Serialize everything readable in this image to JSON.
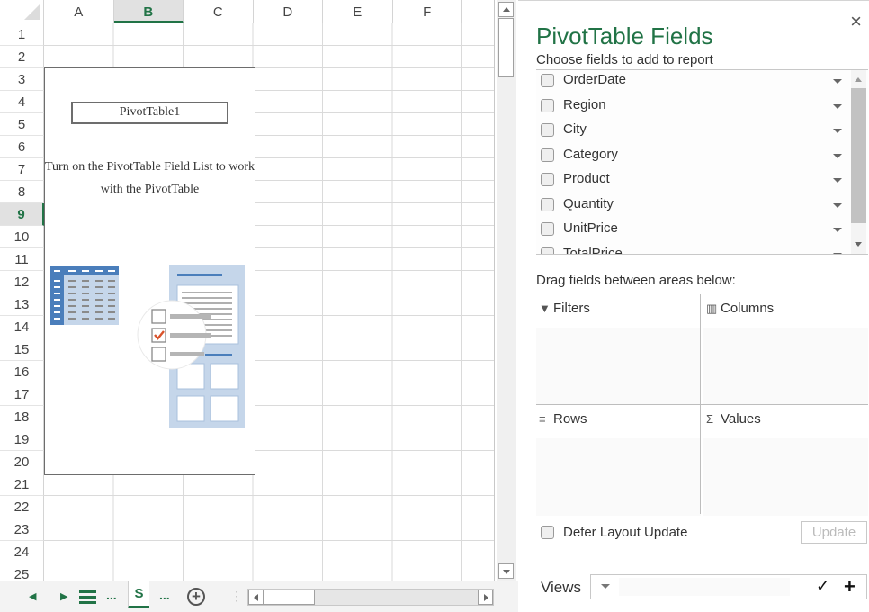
{
  "sheet": {
    "columns": [
      "A",
      "B",
      "C",
      "D",
      "E",
      "F"
    ],
    "selected_column": "B",
    "rows": [
      "1",
      "2",
      "3",
      "4",
      "5",
      "6",
      "7",
      "8",
      "9",
      "10",
      "11",
      "12",
      "13",
      "14",
      "15",
      "16",
      "17",
      "18",
      "19",
      "20",
      "21",
      "22",
      "23",
      "24",
      "25"
    ],
    "selected_row": "9",
    "pivot_placeholder": {
      "name": "PivotTable1",
      "message": "Turn on the PivotTable Field List to work with the PivotTable"
    },
    "colors": {
      "accent": "#217346",
      "illustration_blue": "#4a7ebb",
      "illustration_light": "#c5d6ea",
      "check_red": "#d9532c"
    }
  },
  "tabbar": {
    "prev_icon": "triangle-left-icon",
    "next_icon": "triangle-right-icon",
    "all_sheets_icon": "hamburger-icon",
    "more_left": "...",
    "active_tab_label": "S",
    "more_right": "...",
    "add_sheet_icon": "plus-circle-icon"
  },
  "pane": {
    "title": "PivotTable Fields",
    "subtitle": "Choose fields to add to report",
    "close_icon": "×",
    "fields": [
      {
        "label": "OrderDate",
        "checked": false
      },
      {
        "label": "Region",
        "checked": false
      },
      {
        "label": "City",
        "checked": false
      },
      {
        "label": "Category",
        "checked": false
      },
      {
        "label": "Product",
        "checked": false
      },
      {
        "label": "Quantity",
        "checked": false
      },
      {
        "label": "UnitPrice",
        "checked": false
      },
      {
        "label": "TotalPrice",
        "checked": false
      }
    ],
    "drag_label": "Drag fields between areas below:",
    "areas": {
      "filters": {
        "label": "Filters",
        "icon": "▼"
      },
      "columns": {
        "label": "Columns",
        "icon": "▥"
      },
      "rows": {
        "label": "Rows",
        "icon": "≡"
      },
      "values": {
        "label": "Values",
        "icon": "Σ"
      }
    },
    "defer_label": "Defer Layout Update",
    "defer_checked": false,
    "update_label": "Update",
    "views_label": "Views",
    "views_value": "",
    "views_check": "✓",
    "views_plus": "+"
  }
}
